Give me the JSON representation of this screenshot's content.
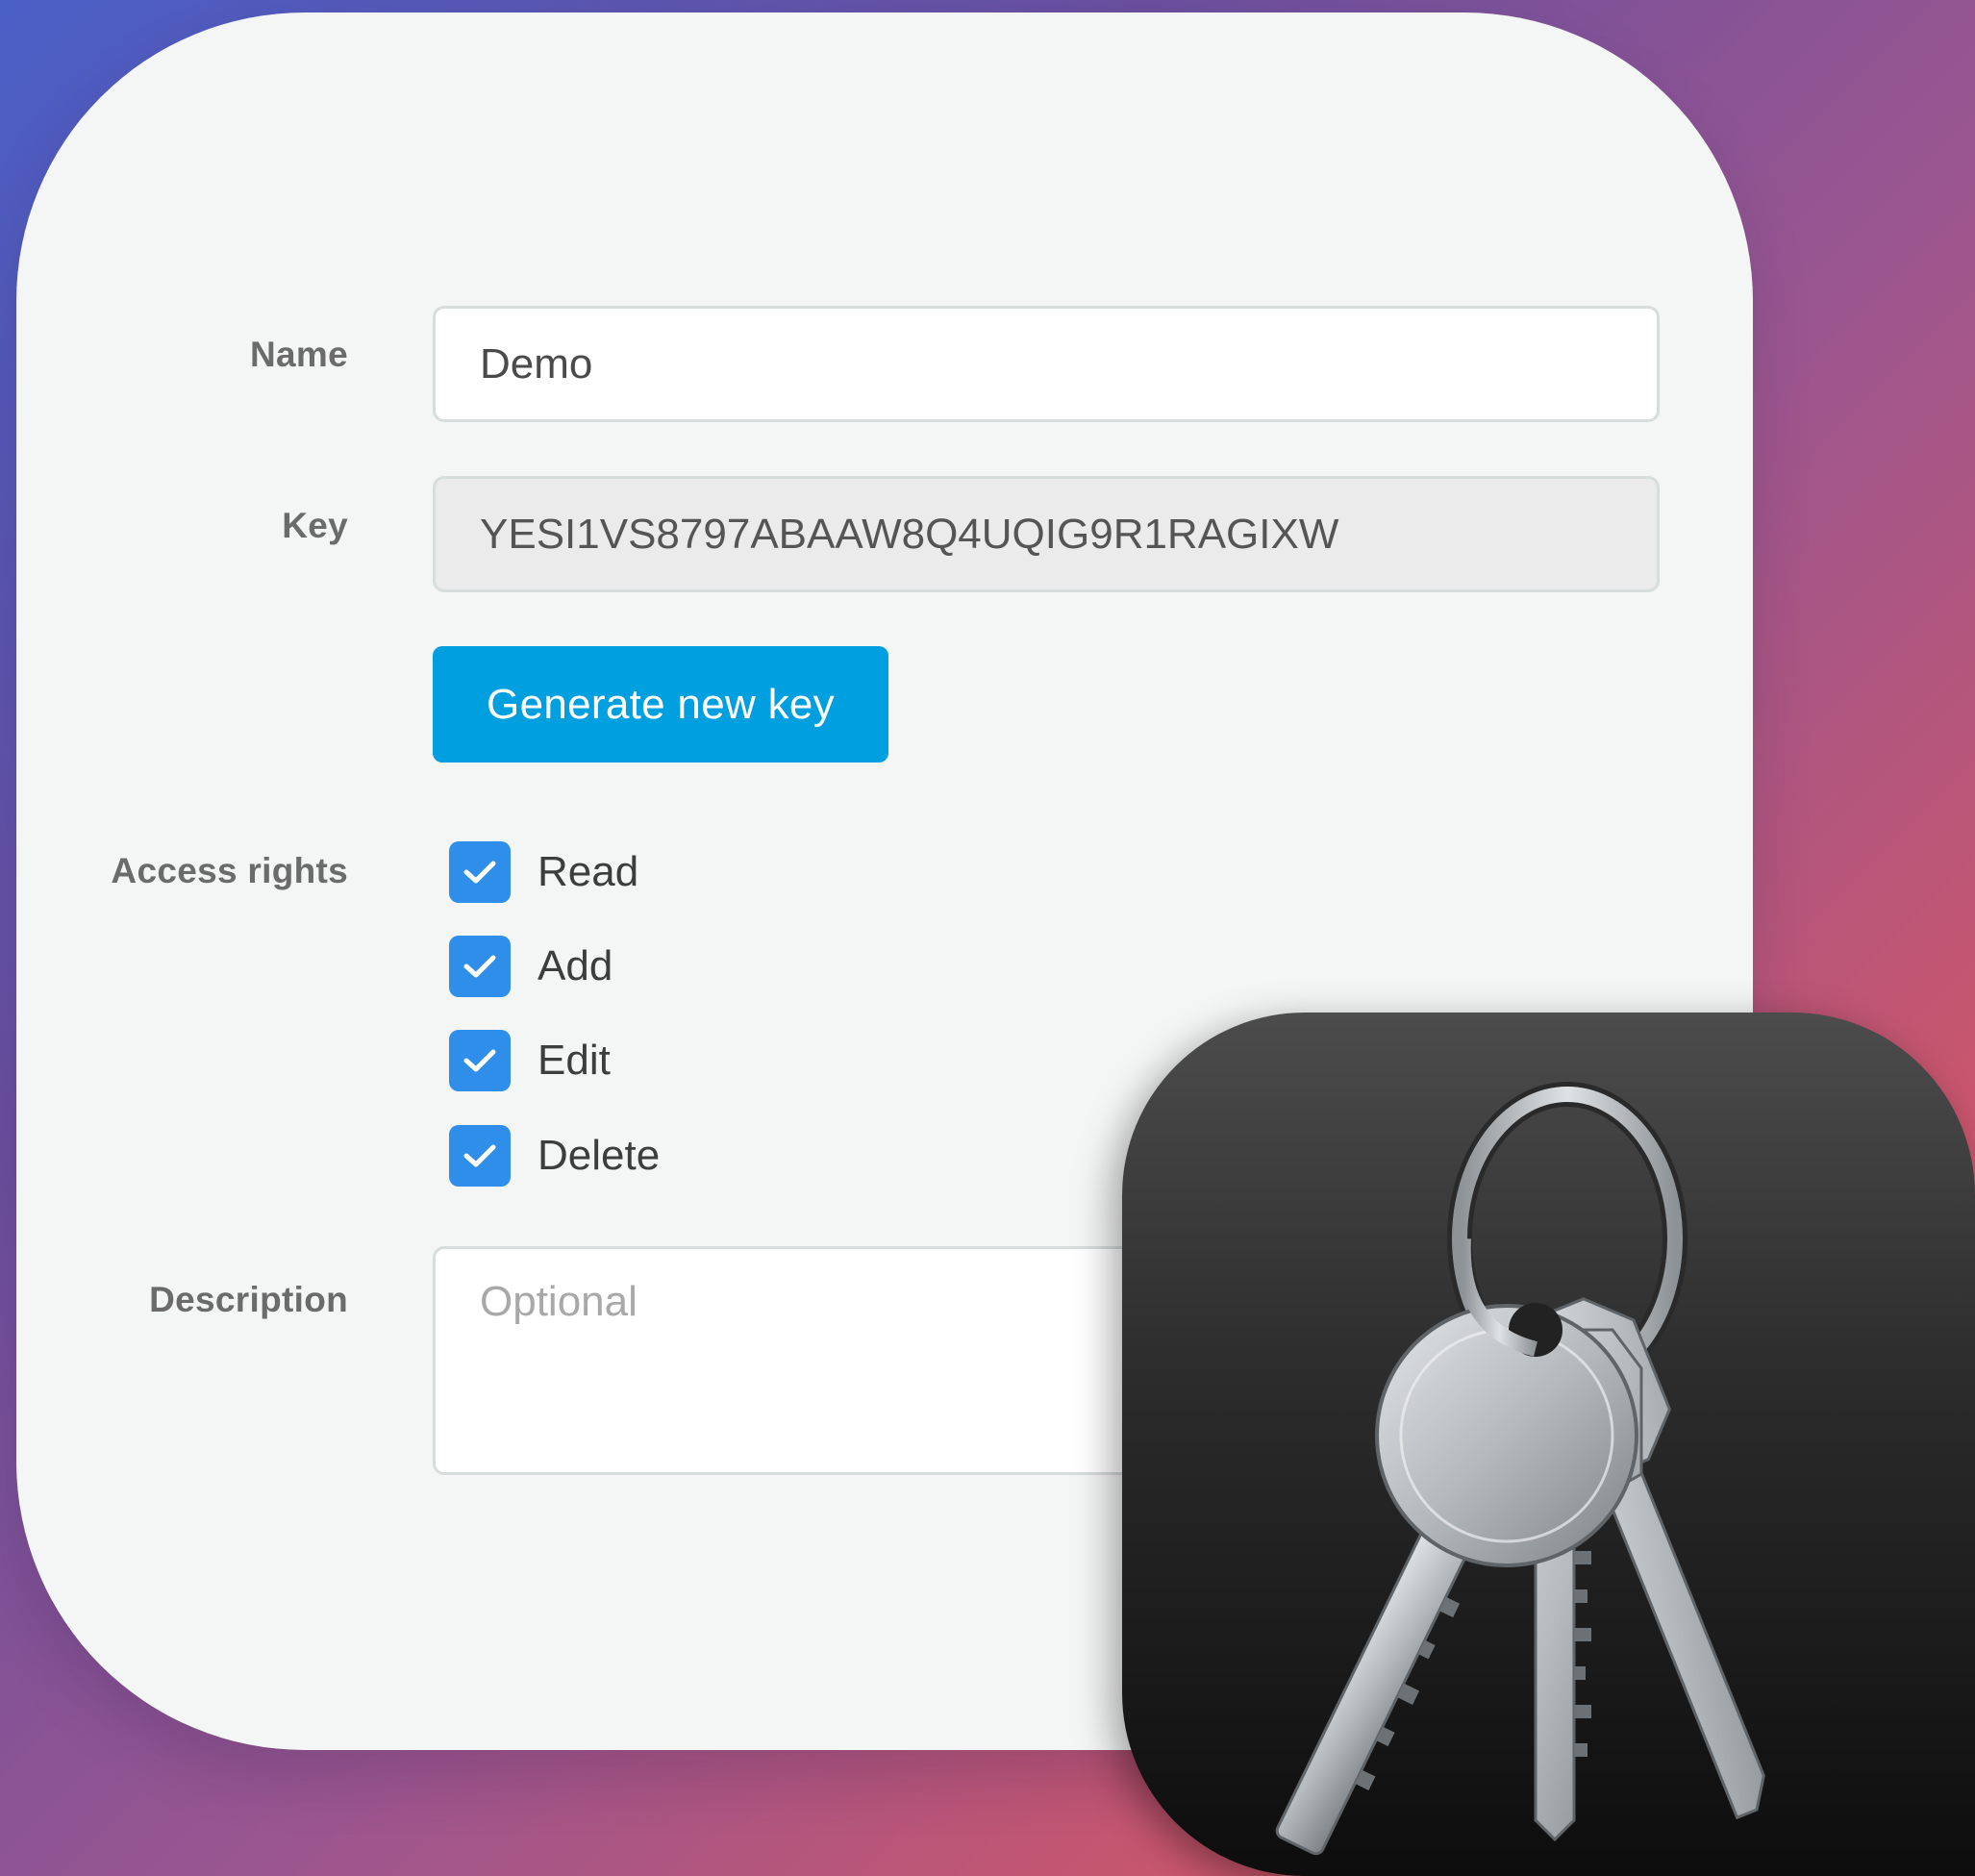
{
  "form": {
    "name_label": "Name",
    "name_value": "Demo",
    "key_label": "Key",
    "key_value": "YESI1VS8797ABAAW8Q4UQIG9R1RAGIXW",
    "generate_button": "Generate new key",
    "access_label": "Access rights",
    "access_rights": [
      {
        "label": "Read",
        "checked": true
      },
      {
        "label": "Add",
        "checked": true
      },
      {
        "label": "Edit",
        "checked": true
      },
      {
        "label": "Delete",
        "checked": true
      }
    ],
    "description_label": "Description",
    "description_placeholder": "Optional"
  },
  "colors": {
    "button": "#009fe0",
    "checkbox": "#2e8eea",
    "card": "#f4f5f5"
  },
  "icons": {
    "app_icon": "keychain-icon",
    "checkmark": "checkmark-icon"
  }
}
